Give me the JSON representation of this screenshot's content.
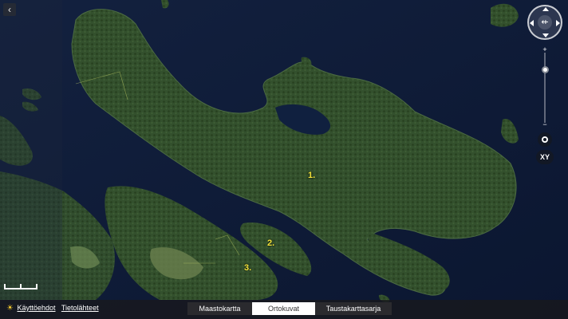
{
  "map": {
    "labels": [
      "1.",
      "2.",
      "3."
    ]
  },
  "controls": {
    "collapse_icon": "chevron-left-icon",
    "collapse_glyph": "‹",
    "compass_icon": "compass-icon",
    "compass_glyph": "⇷",
    "zoom_in": "+",
    "zoom_out": "−",
    "locate_icon": "locate-icon",
    "xy_label": "XY"
  },
  "footer": {
    "info_icon": "lightbulb-icon",
    "info_glyph": "☀",
    "links": [
      "Käyttöehdot",
      "Tietolähteet"
    ]
  },
  "tabs": [
    {
      "label": "Maastokartta",
      "active": false
    },
    {
      "label": "Ortokuvat",
      "active": true
    },
    {
      "label": "Taustakarttasarja",
      "active": false
    }
  ],
  "colors": {
    "water": "#0e1a33",
    "forest": "#2f4a2b",
    "label": "#f2e23a",
    "footer": "#18181c"
  }
}
